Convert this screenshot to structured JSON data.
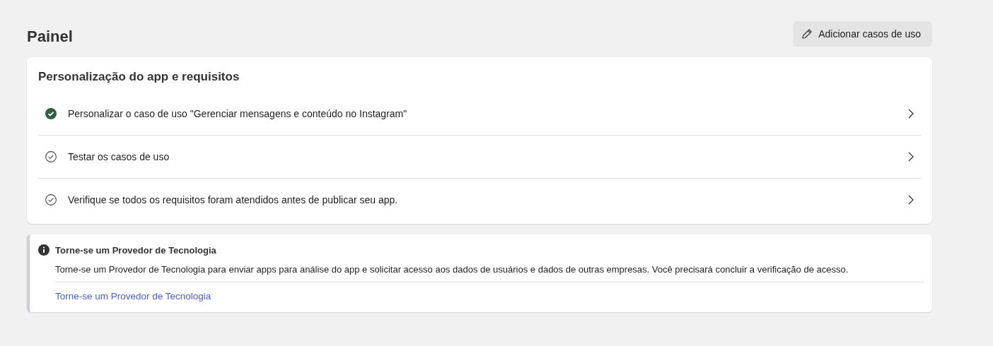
{
  "page_title": "Painel",
  "add_button": {
    "label": "Adicionar casos de uso"
  },
  "requirements_card": {
    "title": "Personalização do app e requisitos",
    "items": [
      {
        "label": "Personalizar o caso de uso \"Gerenciar mensagens e conteúdo no Instagram\"",
        "completed": true
      },
      {
        "label": "Testar os casos de uso",
        "completed": false
      },
      {
        "label": "Verifique se todos os requisitos foram atendidos antes de publicar seu app.",
        "completed": false
      }
    ]
  },
  "notice": {
    "title": "Torne-se um Provedor de Tecnologia",
    "body": "Torne-se um Provedor de Tecnologia para enviar apps para análise do app e solicitar acesso aos dados de usuários e dados de outras empresas. Você precisará concluir a verificação de acesso.",
    "link": "Torne-se um Provedor de Tecnologia"
  }
}
